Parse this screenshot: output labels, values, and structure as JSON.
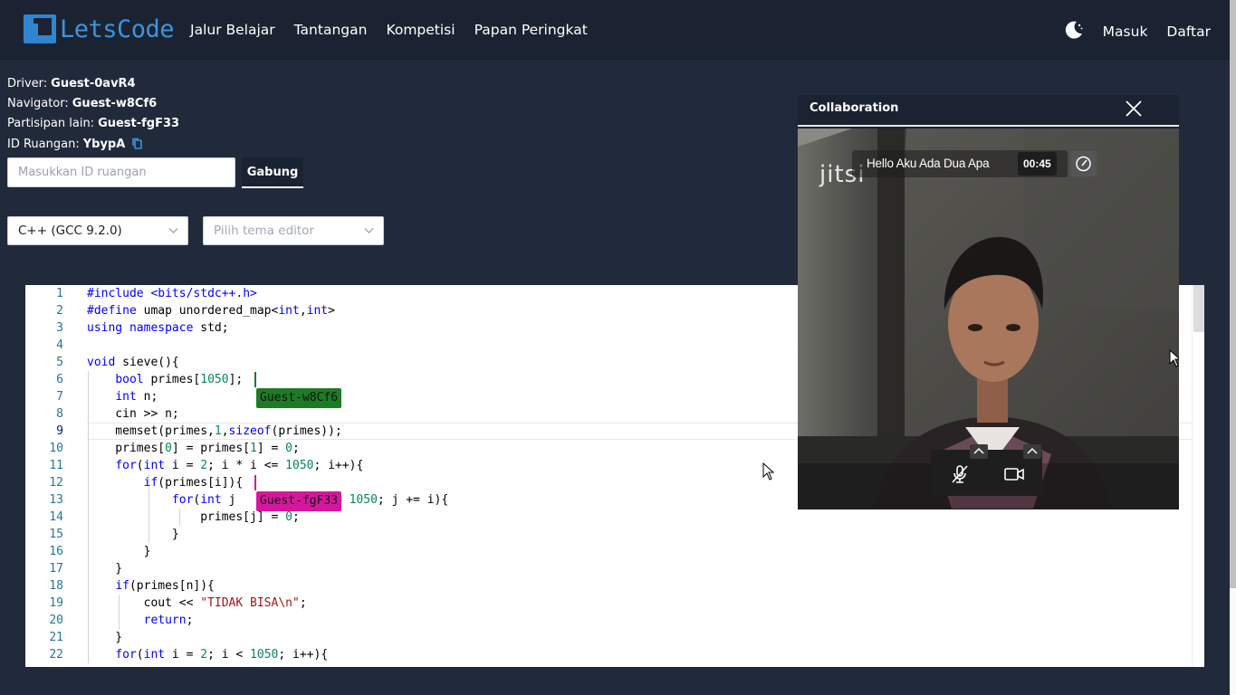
{
  "navbar": {
    "brand": "LetsCode",
    "links": [
      "Jalur Belajar",
      "Tantangan",
      "Kompetisi",
      "Papan Peringkat"
    ],
    "login": "Masuk",
    "register": "Daftar"
  },
  "session": {
    "driver_label": "Driver:",
    "driver": "Guest-0avR4",
    "navigator_label": "Navigator:",
    "navigator": "Guest-w8Cf6",
    "others_label": "Partisipan lain:",
    "others": "Guest-fgF33",
    "room_label": "ID Ruangan:",
    "room_id": "YbypA"
  },
  "join": {
    "placeholder": "Masukkan ID ruangan",
    "button": "Gabung"
  },
  "language_select": "C++ (GCC 9.2.0)",
  "theme_select_placeholder": "Pilih tema editor",
  "editor": {
    "line_numbers": [
      "1",
      "2",
      "3",
      "4",
      "5",
      "6",
      "7",
      "8",
      "9",
      "10",
      "11",
      "12",
      "13",
      "14",
      "15",
      "16",
      "17",
      "18",
      "19",
      "20",
      "21",
      "22"
    ],
    "cursor_tags": [
      {
        "name": "Guest-w8Cf6",
        "color": "#1e7b25"
      },
      {
        "name": "Guest-fgF33",
        "color": "#d6179e"
      }
    ]
  },
  "collaboration": {
    "title": "Collaboration",
    "meeting_title": "Hello Aku Ada Dua Apa",
    "meeting_time": "00:45",
    "video_brand": "jitsi"
  },
  "colors": {
    "background": "#212a3a",
    "navbar": "#1b2332",
    "brand": "#3b95dd"
  }
}
